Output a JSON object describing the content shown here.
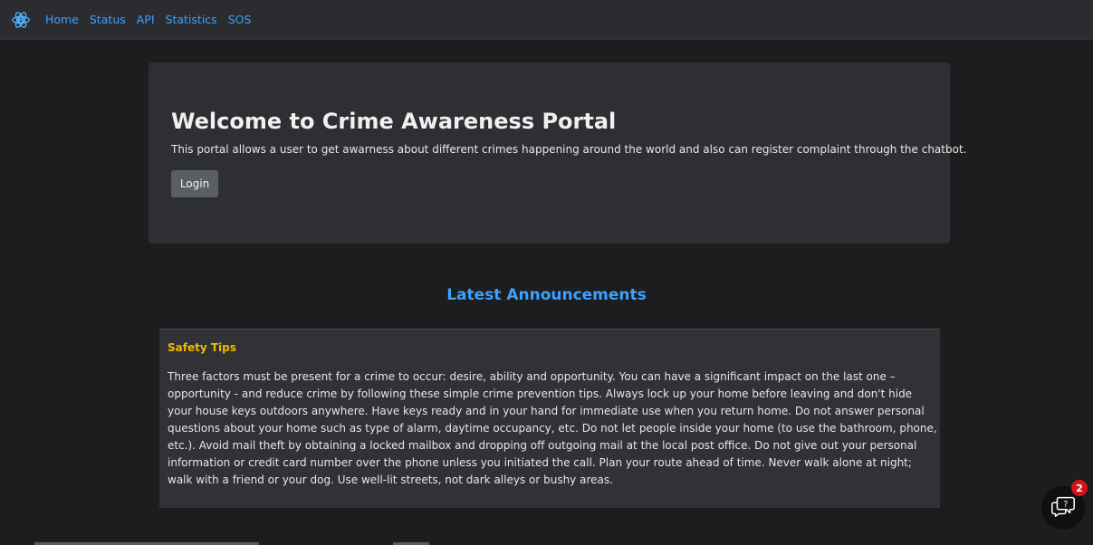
{
  "nav": {
    "brand_icon": "react-bootstrap-logo",
    "links": [
      "Home",
      "Status",
      "API",
      "Statistics",
      "SOS"
    ]
  },
  "hero": {
    "title": "Welcome to Crime Awareness Portal",
    "description": "This portal allows a user to get awarness about different crimes happening around the world and also can register complaint through the chatbot.",
    "login_label": "Login"
  },
  "announcements": {
    "heading": "Latest Announcements",
    "card": {
      "title": "Safety Tips",
      "body": "Three factors must be present for a crime to occur: desire, ability and opportunity. You can have a significant impact on the last one – opportunity - and reduce crime by following these simple crime prevention tips. Always lock up your home before leaving and don't hide your house keys outdoors anywhere. Have keys ready and in your hand for immediate use when you return home. Do not answer personal questions about your home such as type of alarm, daytime occupancy, etc. Do not let people inside your home (to use the bathroom, phone, etc.). Avoid mail theft by obtaining a locked mailbox and dropping off outgoing mail at the local post office. Do not give out your personal information or credit card number over the phone unless you initiated the call. Plan your route ahead of time. Never walk alone at night; walk with a friend or your dog. Use well-lit streets, not dark alleys or bushy areas."
    }
  },
  "chat": {
    "icon": "chat-help-icon",
    "badge_count": "2"
  },
  "colors": {
    "accent": "#3ea0ff",
    "warning": "#f5b800",
    "badge": "#d4131a"
  }
}
